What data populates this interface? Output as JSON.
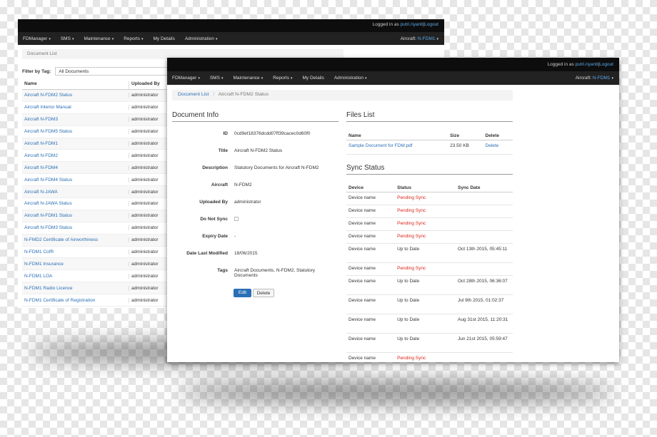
{
  "colors": {
    "accent": "#2a6fb5",
    "pending": "#d9261c",
    "navbar": "#222222"
  },
  "back_window": {
    "login_prefix": "Logged in as",
    "login_user": "putri.riyanti",
    "login_sep": "|",
    "logout": "Logout",
    "nav": [
      "FDManager",
      "SMS",
      "Maintenance",
      "Reports",
      "My Details",
      "Administration"
    ],
    "nav_dropdown": [
      true,
      true,
      true,
      true,
      false,
      true
    ],
    "aircraft_label": "Aircraft:",
    "aircraft_value": "N-FDM1",
    "breadcrumb": "Document List",
    "filter_label": "Filter by Tag:",
    "filter_value": "All Documents",
    "columns": [
      "Name",
      "Uploaded By"
    ],
    "rows": [
      [
        "Aircraft N-FDM2 Status",
        "administrator"
      ],
      [
        "Aircraft Interior Manual",
        "administrator"
      ],
      [
        "Aircraft N-FDM3",
        "administrator"
      ],
      [
        "Aircraft N-FDM5 Status",
        "administrator"
      ],
      [
        "Aircraft N-FDM1",
        "administrator"
      ],
      [
        "Aircraft N-FDM2",
        "administrator"
      ],
      [
        "Aircraft N-FDM4",
        "administrator"
      ],
      [
        "Aircraft N-FDM4 Status",
        "administrator"
      ],
      [
        "Aircraft N-JAWA",
        "administrator"
      ],
      [
        "Aircraft N-JAWA Status",
        "administrator"
      ],
      [
        "Aircraft N-FDM1 Status",
        "administrator"
      ],
      [
        "Aircraft N-FDM3 Status",
        "administrator"
      ],
      [
        "N-FMD2 Certificate of Airworthiness",
        "administrator"
      ],
      [
        "N-FDM1 CofR",
        "administrator"
      ],
      [
        "N-FDM1 Insurance",
        "administrator"
      ],
      [
        "N-FDM1 LOA",
        "administrator"
      ],
      [
        "N-FDM1 Radio Licence",
        "administrator"
      ],
      [
        "N-FDM1 Certificate of Registration",
        "administrator"
      ]
    ]
  },
  "front_window": {
    "login_prefix": "Logged in as",
    "login_user": "putri.riyanti",
    "login_sep": "|",
    "logout": "Logout",
    "nav": [
      "FDManager",
      "SMS",
      "Maintenance",
      "Reports",
      "My Details",
      "Administration"
    ],
    "nav_dropdown": [
      true,
      true,
      true,
      true,
      false,
      true
    ],
    "aircraft_label": "Aircraft:",
    "aircraft_value": "N-FDM1",
    "breadcrumb_link": "Document List",
    "breadcrumb_sep": "/",
    "breadcrumb_current": "Aircraft N-FDM2 Status",
    "doc_info_title": "Document Info",
    "fields": [
      {
        "label": "ID",
        "value": "0cd9ef18376dcdd07ff39cacec0d60f0"
      },
      {
        "label": "Title",
        "value": "Aircraft N-FDM2 Status"
      },
      {
        "label": "Description",
        "value": "Statutory Documents for Aircraft N-FDM2"
      },
      {
        "label": "Aircraft",
        "value": "N-FDM2"
      },
      {
        "label": "Uploaded By",
        "value": "administrator"
      },
      {
        "label": "Do Not Sync",
        "value": ""
      },
      {
        "label": "Expiry Date",
        "value": "-"
      },
      {
        "label": "Date Last Modified",
        "value": "18/06/2015"
      },
      {
        "label": "Tags",
        "value": "Aircraft Documents, N-FDM2, Statutory Documents"
      }
    ],
    "edit_label": "Edit",
    "delete_label": "Delete",
    "files_title": "Files List",
    "files_columns": [
      "Name",
      "Size",
      "Delete"
    ],
    "files": [
      {
        "name": "Sample Document for FDM.pdf",
        "size": "23.50 KB",
        "action": "Delete"
      }
    ],
    "sync_title": "Sync Status",
    "sync_columns": [
      "Device",
      "Status",
      "Sync Date"
    ],
    "sync_rows": [
      {
        "device": "Device name",
        "status": "Pending Sync",
        "pending": true,
        "date": ""
      },
      {
        "device": "Device name",
        "status": "Pending Sync",
        "pending": true,
        "date": ""
      },
      {
        "device": "Device name",
        "status": "Pending Sync",
        "pending": true,
        "date": ""
      },
      {
        "device": "Device name",
        "status": "Pending Sync",
        "pending": true,
        "date": ""
      },
      {
        "device": "Device name",
        "status": "Up to Date",
        "pending": false,
        "date": "Oct 13th 2015, 05:45:11"
      },
      {
        "device": "Device name",
        "status": "Pending Sync",
        "pending": true,
        "date": ""
      },
      {
        "device": "Device name",
        "status": "Up to Date",
        "pending": false,
        "date": "Oct 28th 2015, 06:36:07"
      },
      {
        "device": "Device name",
        "status": "Up to Date",
        "pending": false,
        "date": "Jul 9th 2015, 01:02:37"
      },
      {
        "device": "Device name",
        "status": "Up to Date",
        "pending": false,
        "date": "Aug 31st 2015, 11:20:31"
      },
      {
        "device": "Device name",
        "status": "Up to Date",
        "pending": false,
        "date": "Jun 21st 2015, 05:59:47"
      },
      {
        "device": "Device name",
        "status": "Pending Sync",
        "pending": true,
        "date": ""
      }
    ]
  }
}
